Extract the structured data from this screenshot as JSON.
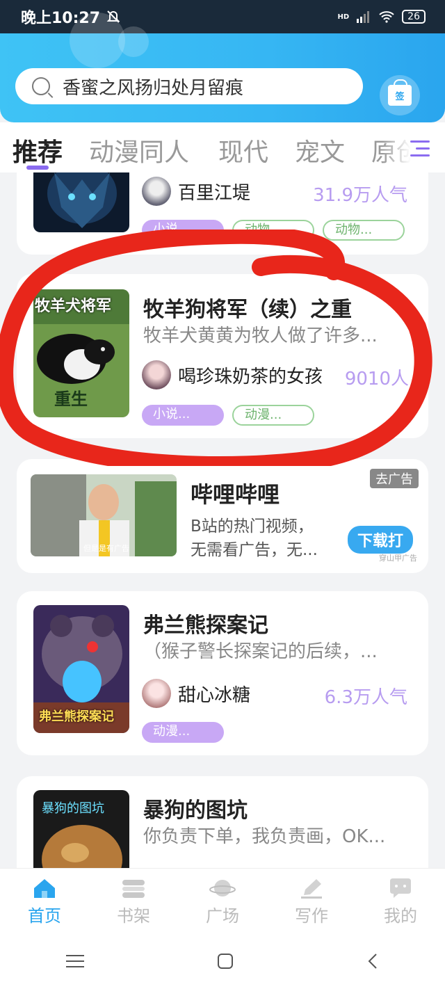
{
  "status_bar": {
    "time": "晚上10:27",
    "network": "HD",
    "battery": "26"
  },
  "search": {
    "query": "香蜜之风扬归处月留痕",
    "gift_label": "签"
  },
  "tabs": [
    {
      "label": "推荐"
    },
    {
      "label": "动漫同人"
    },
    {
      "label": "现代"
    },
    {
      "label": "宠文"
    },
    {
      "label": "原创"
    }
  ],
  "cards": [
    {
      "title": "",
      "desc": "",
      "author": "百里江堤",
      "popularity": "31.9万人气",
      "tags": [
        "小说...",
        "动物...",
        "动物..."
      ]
    },
    {
      "title": "牧羊狗将军（续）之重",
      "desc": "牧羊犬黄黄为牧人做了许多...",
      "author": "喝珍珠奶茶的女孩",
      "popularity": "9010人",
      "cover_text": "牧羊犬将军",
      "cover_sub": "重生",
      "tags": [
        "小说...",
        "动漫..."
      ]
    },
    {
      "title": "弗兰熊探案记",
      "desc": "（猴子警长探案记的后续，...",
      "author": "甜心冰糖",
      "popularity": "6.3万人气",
      "cover_text": "弗兰熊探案记",
      "tags": [
        "动漫..."
      ]
    },
    {
      "title": "暴狗的图坑",
      "desc": "你负责下单，我负责画，OK...",
      "cover_text": "暴狗的图坑"
    }
  ],
  "ad": {
    "title": "哔哩哔哩",
    "desc_line1": "B站的热门视频，",
    "desc_line2": "无需看广告，无...",
    "close_label": "去广告",
    "button_label": "下载打",
    "source": "穿山甲广告",
    "caption": "但是是有广告"
  },
  "bottom_nav": [
    {
      "label": "首页",
      "icon": "home-icon",
      "active": true
    },
    {
      "label": "书架",
      "icon": "bookshelf-icon"
    },
    {
      "label": "广场",
      "icon": "planet-icon"
    },
    {
      "label": "写作",
      "icon": "pen-icon"
    },
    {
      "label": "我的",
      "icon": "chat-bubble-icon"
    }
  ],
  "colors": {
    "accent": "#2aa5ee",
    "purple": "#8b6cf0",
    "annotation": "#e8261b"
  }
}
